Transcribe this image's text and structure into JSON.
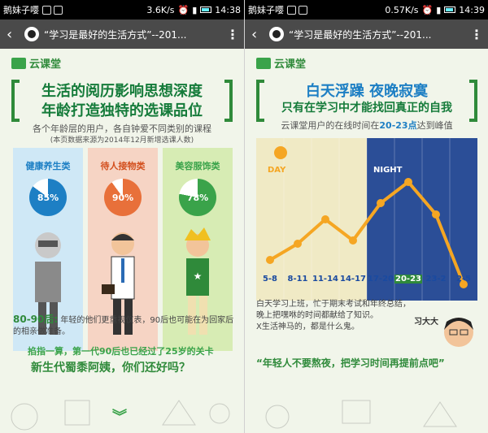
{
  "left": {
    "status": {
      "carrier": "鹅妹子嘤",
      "speed": "3.6K/s",
      "time": "14:38"
    },
    "titlebar": {
      "title": "“学习是最好的生活方式”--201..."
    },
    "logo": "云课堂",
    "headline": {
      "line1": "生活的阅历影响思想深度",
      "line2": "年龄打造独特的选课品位"
    },
    "subtitle": "各个年龄层的用户，各自钟爱不同类别的课程",
    "source": "(本页数据来源为2014年12月新增选课人数)",
    "categories": [
      {
        "name": "健康养生类",
        "percent": "85%",
        "value": 85
      },
      {
        "name": "待人接物类",
        "percent": "90%",
        "value": 90
      },
      {
        "name": "美容服饰类",
        "percent": "78%",
        "value": 78
      }
    ],
    "para_lead": "80-90后:",
    "para": "年轻的他们更重视仪表，90后也可能在为回家后的相亲做准备。",
    "highlight1": "掐指一算，第一代90后也已经过了25岁的关卡",
    "highlight2": "新生代蜀黍阿姨，你们还好吗？"
  },
  "right": {
    "status": {
      "carrier": "鹅妹子嘤",
      "speed": "0.57K/s",
      "time": "14:39"
    },
    "titlebar": {
      "title": "“学习是最好的生活方式”--201..."
    },
    "logo": "云课堂",
    "headline": {
      "line1": "白天浮躁  夜晚寂寞",
      "line2": "只有在学习中才能找回真正的自我"
    },
    "subtitle_pre": "云课堂用户的在线时间在",
    "subtitle_hl": "20-23点",
    "subtitle_post": "达到峰值",
    "day_label": "DAY",
    "night_label": "NIGHT",
    "body1": "白天学习上班，忙于期末考试和年终总结，",
    "body2": "晚上把嘿咻的时间都献给了知识。",
    "body3": "X生活神马的，都是什么鬼。",
    "character": "习大大",
    "quote": "“年轻人不要熬夜，把学习时间再提前点吧”"
  },
  "colors": {
    "green": "#2f8a3a",
    "blue": "#1a4aa0",
    "orange": "#f5a623",
    "sky_day": "#f0eac5",
    "sky_night": "#2b4e97"
  },
  "chart_data": {
    "type": "line",
    "categories": [
      "5-8",
      "8-11",
      "11-14",
      "14-17",
      "17-20",
      "20-23",
      "23-2",
      "2-5"
    ],
    "values": [
      2,
      3,
      4.5,
      3.2,
      5.5,
      6.8,
      4.8,
      0.5
    ],
    "ylim": [
      0,
      8
    ],
    "highlight_category": "20-23"
  }
}
